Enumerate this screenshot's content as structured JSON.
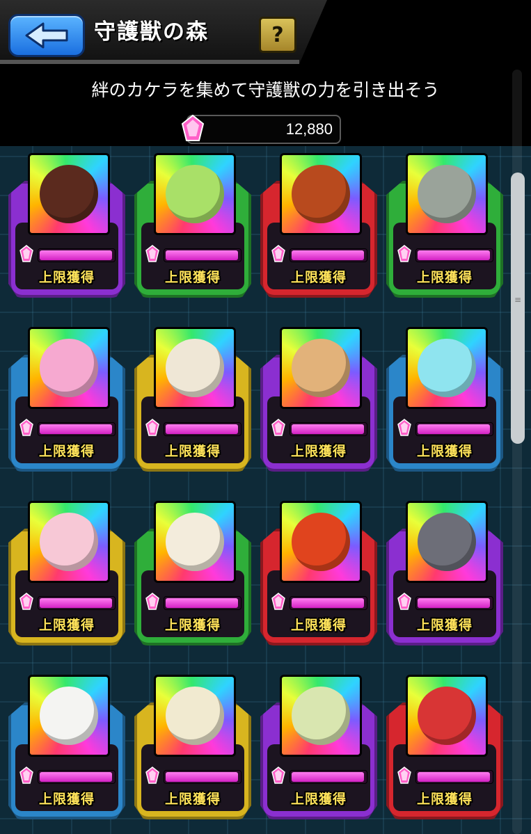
{
  "header": {
    "title": "守護獣の森",
    "help_label": "?",
    "subtitle": "絆のカケラを集めて守護獣の力を引き出そう",
    "currency": {
      "icon": "pink-gem-icon",
      "value": "12,880"
    }
  },
  "colors": {
    "purple": "#8b2fd0",
    "green": "#2fae3a",
    "red": "#d6262e",
    "blue": "#2b86c9",
    "yellow": "#d8b51f",
    "gauge": "#e23fd6"
  },
  "cards": [
    {
      "frame": "purple",
      "figure": "#5b2a1e",
      "label": "上限獲得",
      "progress": 1
    },
    {
      "frame": "green",
      "figure": "#a9e068",
      "label": "上限獲得",
      "progress": 1
    },
    {
      "frame": "red",
      "figure": "#b84a1e",
      "label": "上限獲得",
      "progress": 1
    },
    {
      "frame": "green",
      "figure": "#9aa39a",
      "label": "上限獲得",
      "progress": 1
    },
    {
      "frame": "blue",
      "figure": "#f6a9d0",
      "label": "上限獲得",
      "progress": 1
    },
    {
      "frame": "yellow",
      "figure": "#efe7d6",
      "label": "上限獲得",
      "progress": 1
    },
    {
      "frame": "purple",
      "figure": "#e2b27a",
      "label": "上限獲得",
      "progress": 1
    },
    {
      "frame": "blue",
      "figure": "#8fe4ef",
      "label": "上限獲得",
      "progress": 1
    },
    {
      "frame": "yellow",
      "figure": "#f7c8d6",
      "label": "上限獲得",
      "progress": 1
    },
    {
      "frame": "green",
      "figure": "#f3ecdc",
      "label": "上限獲得",
      "progress": 1
    },
    {
      "frame": "red",
      "figure": "#e0441e",
      "label": "上限獲得",
      "progress": 1
    },
    {
      "frame": "purple",
      "figure": "#6d6e78",
      "label": "上限獲得",
      "progress": 1
    },
    {
      "frame": "blue",
      "figure": "#f4f4f2",
      "label": "上限獲得",
      "progress": 1
    },
    {
      "frame": "yellow",
      "figure": "#f1ead0",
      "label": "上限獲得",
      "progress": 1
    },
    {
      "frame": "purple",
      "figure": "#d9e6b0",
      "label": "上限獲得",
      "progress": 1
    },
    {
      "frame": "red",
      "figure": "#d83535",
      "label": "上限獲得",
      "progress": 1
    }
  ]
}
